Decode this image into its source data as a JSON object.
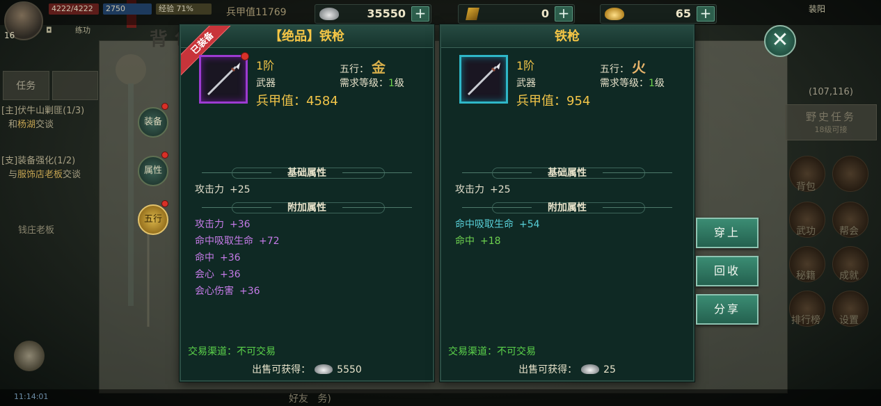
{
  "hud": {
    "level": "16",
    "hp": "4222/4222",
    "mp": "2750",
    "mp_prefix": "2",
    "exp": "经验 71%",
    "power": "兵甲值11769",
    "auto_label": "练功",
    "right_text": "装阳",
    "currencies": [
      {
        "name": "silver-ingot-icon",
        "amount": "35550"
      },
      {
        "name": "ticket-icon",
        "amount": "0"
      },
      {
        "name": "gold-ingot-icon",
        "amount": "65"
      }
    ]
  },
  "left_panel": {
    "tabs": [
      "任务",
      ""
    ],
    "tasks": [
      {
        "title": "[主]伏牛山剿匪(1/3)",
        "desc_pre": "和",
        "desc_npc": "杨湖",
        "desc_post": "交谈"
      },
      {
        "title": "[支]装备强化(1/2)",
        "desc_pre": "与",
        "desc_npc": "服饰店老板",
        "desc_post": "交谈"
      }
    ],
    "npc": "钱庄老板"
  },
  "bag": {
    "title": "背包",
    "side_tabs": [
      "装备",
      "属性",
      "五行"
    ]
  },
  "right_panel": {
    "coord": "(107,116)",
    "wild_task_title": "野史任务",
    "wild_task_sub": "18级可接",
    "menu": [
      "背包",
      "武功",
      "帮会",
      "秘籍",
      "成就",
      "排行榜",
      "设置"
    ]
  },
  "equipped_card": {
    "ribbon": "已装备",
    "title": "【绝品】铁枪",
    "tier": "1阶",
    "wuxing_label": "五行：",
    "wuxing_glyph": "金",
    "type": "武器",
    "req_label": "需求等级：",
    "req_level": "1",
    "req_unit": "级",
    "power_label": "兵甲值：",
    "power_value": "4584",
    "base_title": "基础属性",
    "base_attrs": [
      {
        "name": "攻击力",
        "value": "+25"
      }
    ],
    "extra_title": "附加属性",
    "extra_attrs": [
      {
        "name": "攻击力",
        "value": "+36"
      },
      {
        "name": "命中吸取生命",
        "value": "+72"
      },
      {
        "name": "命中",
        "value": "+36"
      },
      {
        "name": "会心",
        "value": "+36"
      },
      {
        "name": "会心伤害",
        "value": "+36"
      }
    ],
    "trade": "交易渠道：不可交易",
    "sell_label": "出售可获得：",
    "sell_value": "5550"
  },
  "compare_card": {
    "title": "铁枪",
    "tier": "1阶",
    "wuxing_label": "五行：",
    "wuxing_glyph": "火",
    "type": "武器",
    "req_label": "需求等级：",
    "req_level": "1",
    "req_unit": "级",
    "power_label": "兵甲值：",
    "power_value": "954",
    "base_title": "基础属性",
    "base_attrs": [
      {
        "name": "攻击力",
        "value": "+25"
      }
    ],
    "extra_title": "附加属性",
    "extra_attrs": [
      {
        "name": "命中吸取生命",
        "value": "+54"
      },
      {
        "name": "命中",
        "value": "+18"
      }
    ],
    "trade": "交易渠道：不可交易",
    "sell_label": "出售可获得：",
    "sell_value": "25"
  },
  "actions": {
    "equip": "穿上",
    "recycle": "回收",
    "share": "分享"
  },
  "bottom": {
    "time": "11:14:01",
    "friends": "好友",
    "tasks": "务)"
  },
  "colors": {
    "equipped_border": "#9c3bd1",
    "compare_border": "#2fb7c8",
    "gold_text": "#f2c549",
    "green_text": "#5bd24a",
    "purple_attr": "#c57be8",
    "cyan_attr": "#58d0d8",
    "button_green": "#2f7a63"
  }
}
